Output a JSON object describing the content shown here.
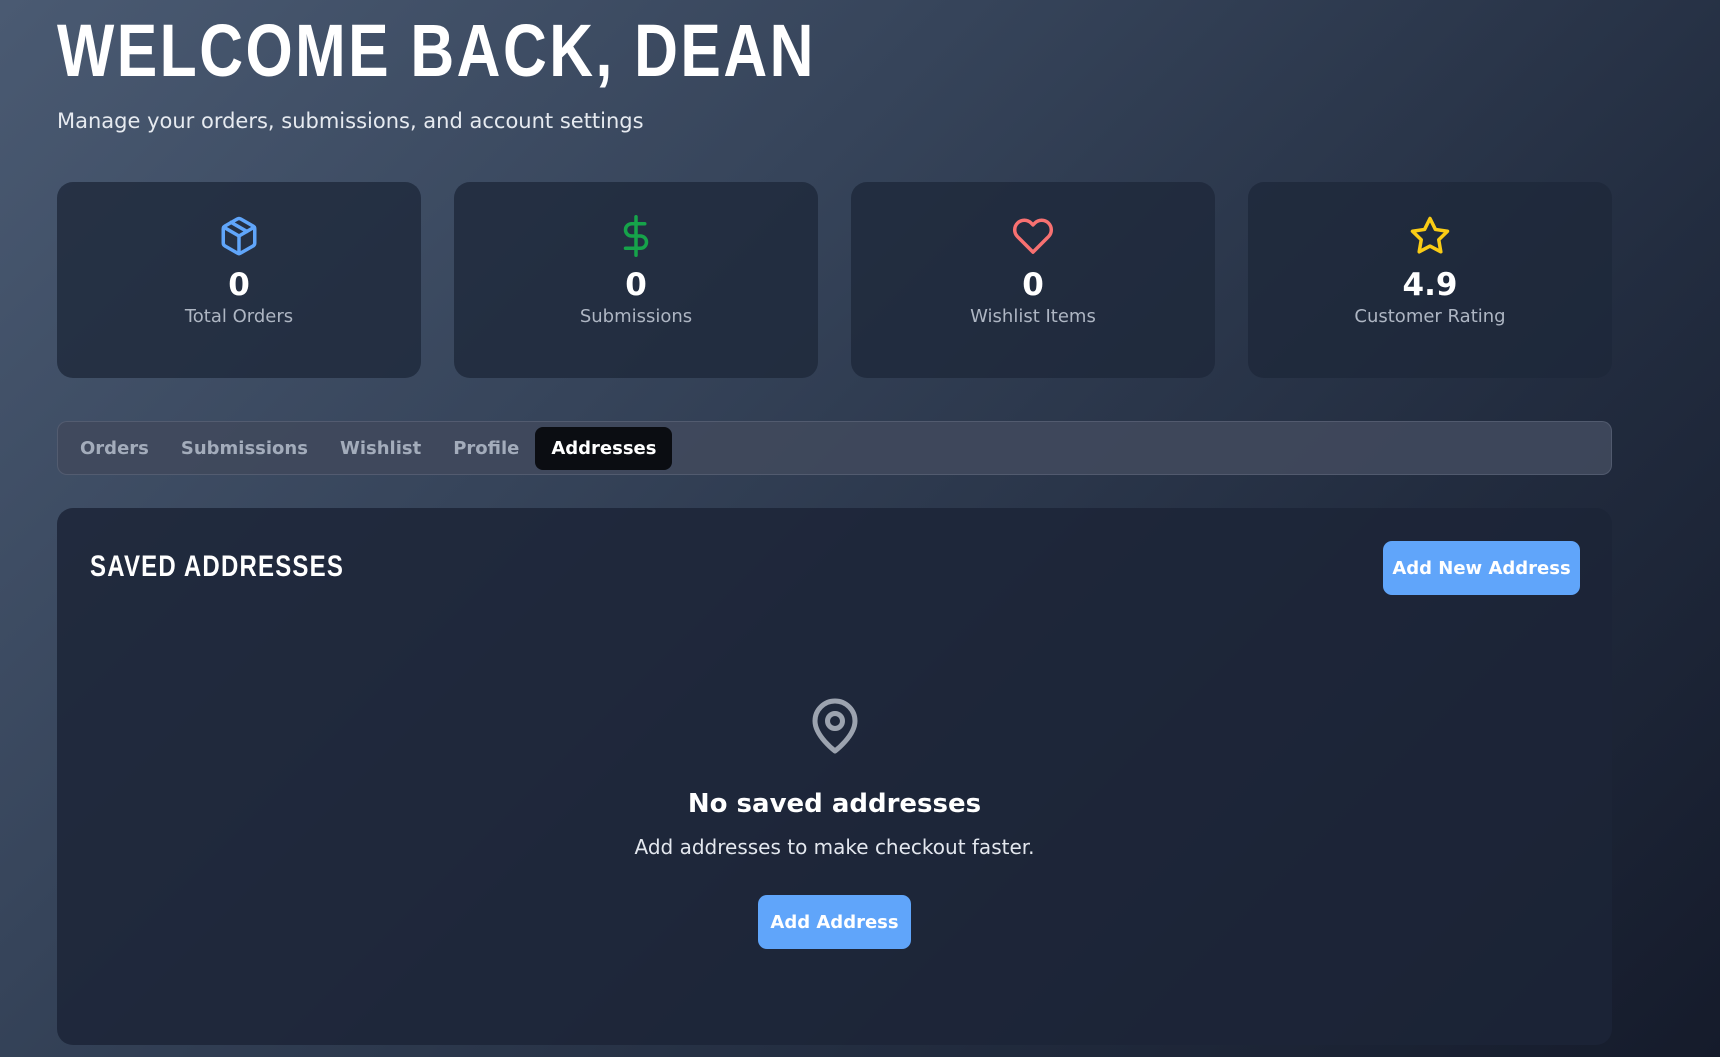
{
  "header": {
    "title": "WELCOME BACK, DEAN",
    "subtitle": "Manage your orders, submissions, and account settings"
  },
  "stats": [
    {
      "icon": "package-icon",
      "value": "0",
      "label": "Total Orders",
      "color": "#60a5fa"
    },
    {
      "icon": "dollar-icon",
      "value": "0",
      "label": "Submissions",
      "color": "#16a34a"
    },
    {
      "icon": "heart-icon",
      "value": "0",
      "label": "Wishlist Items",
      "color": "#f87171"
    },
    {
      "icon": "star-icon",
      "value": "4.9",
      "label": "Customer Rating",
      "color": "#facc15"
    }
  ],
  "tabs": [
    {
      "label": "Orders",
      "active": false
    },
    {
      "label": "Submissions",
      "active": false
    },
    {
      "label": "Wishlist",
      "active": false
    },
    {
      "label": "Profile",
      "active": false
    },
    {
      "label": "Addresses",
      "active": true
    }
  ],
  "addresses": {
    "title": "SAVED ADDRESSES",
    "add_new_label": "Add New Address",
    "empty_icon": "map-pin-icon",
    "empty_title": "No saved addresses",
    "empty_text": "Add addresses to make checkout faster.",
    "add_label": "Add Address"
  },
  "colors": {
    "accent": "#60a5fa",
    "active_tab": "#0b0d12"
  }
}
